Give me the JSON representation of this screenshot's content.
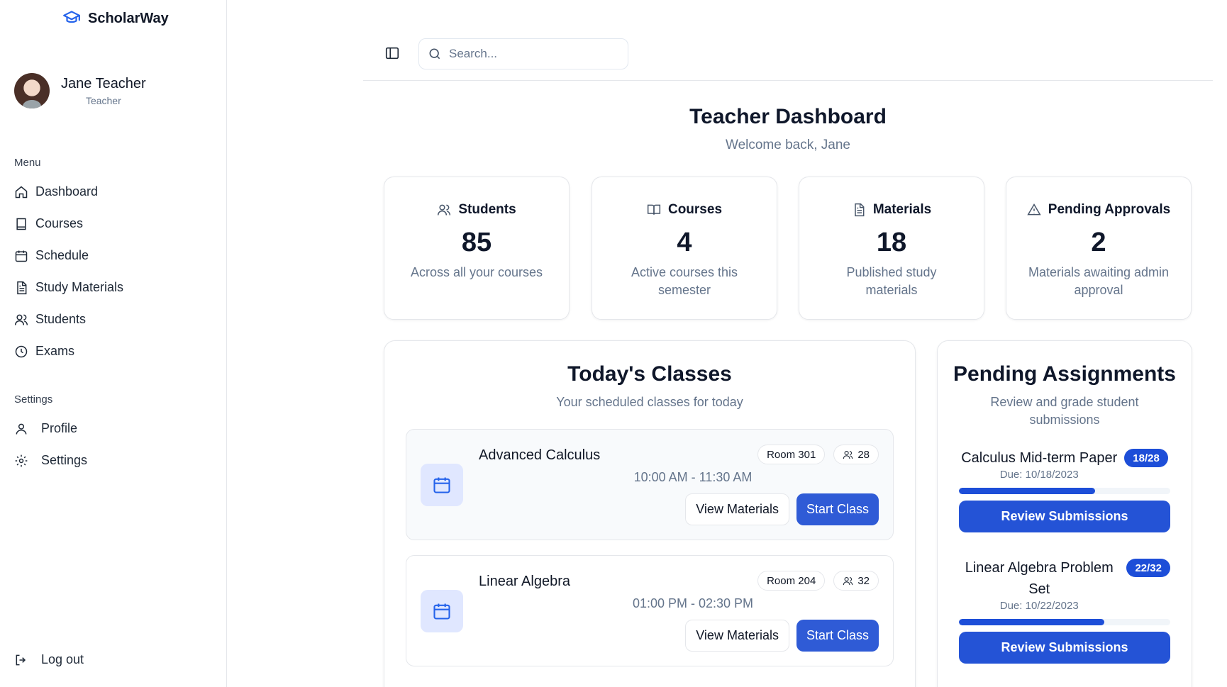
{
  "brand": {
    "name": "ScholarWay"
  },
  "user": {
    "name": "Jane Teacher",
    "role": "Teacher"
  },
  "sidebar": {
    "menu_label": "Menu",
    "menu_items": [
      {
        "label": "Dashboard",
        "icon": "home-icon"
      },
      {
        "label": "Courses",
        "icon": "book-icon"
      },
      {
        "label": "Schedule",
        "icon": "calendar-icon"
      },
      {
        "label": "Study Materials",
        "icon": "file-text-icon"
      },
      {
        "label": "Students",
        "icon": "users-icon"
      },
      {
        "label": "Exams",
        "icon": "clock-icon"
      }
    ],
    "settings_label": "Settings",
    "settings_items": [
      {
        "label": "Profile",
        "icon": "user-icon"
      },
      {
        "label": "Settings",
        "icon": "gear-icon"
      }
    ],
    "logout_label": "Log out"
  },
  "search": {
    "placeholder": "Search..."
  },
  "header": {
    "title": "Teacher Dashboard",
    "subtitle": "Welcome back, Jane"
  },
  "stats": [
    {
      "title": "Students",
      "value": "85",
      "description": "Across all your courses",
      "icon": "users-icon"
    },
    {
      "title": "Courses",
      "value": "4",
      "description": "Active courses this semester",
      "icon": "book-open-icon"
    },
    {
      "title": "Materials",
      "value": "18",
      "description": "Published study materials",
      "icon": "file-text-icon"
    },
    {
      "title": "Pending Approvals",
      "value": "2",
      "description": "Materials awaiting admin approval",
      "icon": "alert-triangle-icon"
    }
  ],
  "todays_classes": {
    "title": "Today's Classes",
    "subtitle": "Your scheduled classes for today",
    "classes": [
      {
        "name": "Advanced Calculus",
        "time": "10:00 AM - 11:30 AM",
        "room": "Room 301",
        "students": "28",
        "view_label": "View Materials",
        "start_label": "Start Class"
      },
      {
        "name": "Linear Algebra",
        "time": "01:00 PM - 02:30 PM",
        "room": "Room 204",
        "students": "32",
        "view_label": "View Materials",
        "start_label": "Start Class"
      }
    ]
  },
  "pending_assignments": {
    "title": "Pending Assignments",
    "subtitle": "Review and grade student submissions",
    "assignments": [
      {
        "title": "Calculus Mid-term Paper",
        "count": "18/28",
        "due": "Due: 10/18/2023",
        "progress": 0.643,
        "button_label": "Review Submissions"
      },
      {
        "title": "Linear Algebra Problem Set",
        "count": "22/32",
        "due": "Due: 10/22/2023",
        "progress": 0.6875,
        "button_label": "Review Submissions"
      }
    ]
  },
  "colors": {
    "primary": "#2f5bd6",
    "accent_dark": "#1d4ed8",
    "muted_text": "#64748b",
    "border": "#e5e7eb"
  }
}
